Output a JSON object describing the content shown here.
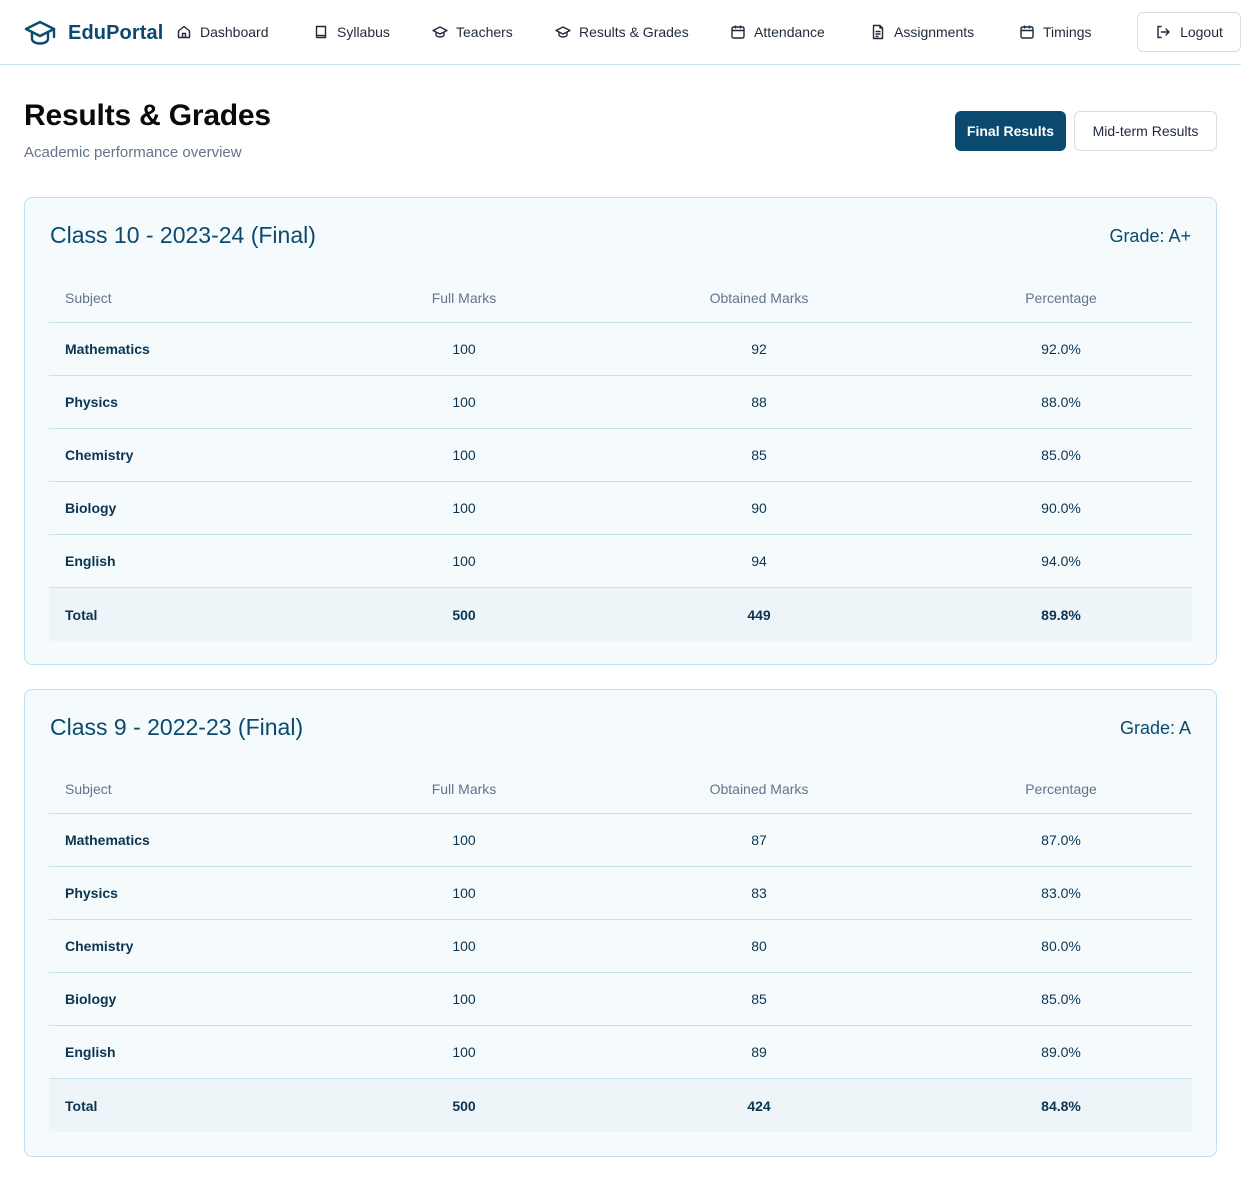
{
  "app": {
    "brand": "EduPortal",
    "brand_icon": "graduation-cap-icon",
    "brand_color": "#0b4a6e"
  },
  "nav": [
    {
      "label": "Dashboard",
      "icon": "home-icon"
    },
    {
      "label": "Syllabus",
      "icon": "book-icon"
    },
    {
      "label": "Teachers",
      "icon": "graduation-cap-icon"
    },
    {
      "label": "Results & Grades",
      "icon": "graduation-cap-icon"
    },
    {
      "label": "Attendance",
      "icon": "calendar-icon"
    },
    {
      "label": "Assignments",
      "icon": "file-text-icon"
    },
    {
      "label": "Timings",
      "icon": "calendar-icon"
    }
  ],
  "logout": {
    "label": "Logout",
    "icon": "logout-icon"
  },
  "header": {
    "title": "Results & Grades",
    "subtitle": "Academic performance overview"
  },
  "toggle": {
    "final_label": "Final Results",
    "midterm_label": "Mid-term Results",
    "selected": "Final Results"
  },
  "table_headers": {
    "subject": "Subject",
    "full": "Full Marks",
    "obtained": "Obtained Marks",
    "percentage": "Percentage"
  },
  "results": [
    {
      "title": "Class 10 - 2023-24 (Final)",
      "grade": "Grade: A+",
      "rows": [
        {
          "subject": "Mathematics",
          "full": "100",
          "obtained": "92",
          "percentage": "92.0%"
        },
        {
          "subject": "Physics",
          "full": "100",
          "obtained": "88",
          "percentage": "88.0%"
        },
        {
          "subject": "Chemistry",
          "full": "100",
          "obtained": "85",
          "percentage": "85.0%"
        },
        {
          "subject": "Biology",
          "full": "100",
          "obtained": "90",
          "percentage": "90.0%"
        },
        {
          "subject": "English",
          "full": "100",
          "obtained": "94",
          "percentage": "94.0%"
        }
      ],
      "total": {
        "subject": "Total",
        "full": "500",
        "obtained": "449",
        "percentage": "89.8%"
      }
    },
    {
      "title": "Class 9 - 2022-23 (Final)",
      "grade": "Grade: A",
      "rows": [
        {
          "subject": "Mathematics",
          "full": "100",
          "obtained": "87",
          "percentage": "87.0%"
        },
        {
          "subject": "Physics",
          "full": "100",
          "obtained": "83",
          "percentage": "83.0%"
        },
        {
          "subject": "Chemistry",
          "full": "100",
          "obtained": "80",
          "percentage": "80.0%"
        },
        {
          "subject": "Biology",
          "full": "100",
          "obtained": "85",
          "percentage": "85.0%"
        },
        {
          "subject": "English",
          "full": "100",
          "obtained": "89",
          "percentage": "89.0%"
        }
      ],
      "total": {
        "subject": "Total",
        "full": "500",
        "obtained": "424",
        "percentage": "84.8%"
      }
    }
  ]
}
